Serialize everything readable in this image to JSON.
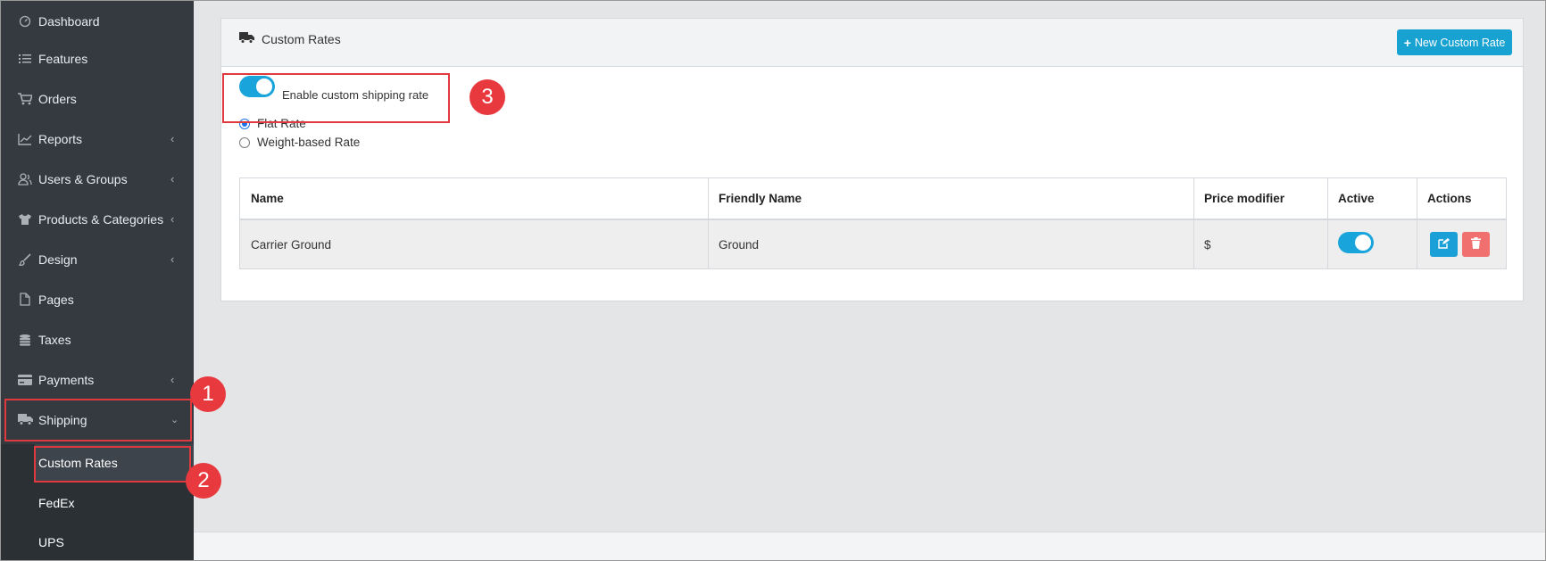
{
  "sidebar": {
    "items": [
      {
        "label": "Dashboard",
        "icon": "dashboard-icon",
        "has_chevron": false
      },
      {
        "label": "Features",
        "icon": "list-icon",
        "has_chevron": false
      },
      {
        "label": "Orders",
        "icon": "cart-icon",
        "has_chevron": false
      },
      {
        "label": "Reports",
        "icon": "chart-line-icon",
        "has_chevron": true
      },
      {
        "label": "Users & Groups",
        "icon": "users-icon",
        "has_chevron": true
      },
      {
        "label": "Products & Categories",
        "icon": "tshirt-icon",
        "has_chevron": true
      },
      {
        "label": "Design",
        "icon": "brush-icon",
        "has_chevron": true
      },
      {
        "label": "Pages",
        "icon": "file-icon",
        "has_chevron": false
      },
      {
        "label": "Taxes",
        "icon": "coins-icon",
        "has_chevron": false
      },
      {
        "label": "Payments",
        "icon": "credit-card-icon",
        "has_chevron": true
      },
      {
        "label": "Shipping",
        "icon": "truck-icon",
        "has_chevron": true,
        "expanded": true
      }
    ],
    "shipping_sub_items": [
      {
        "label": "Custom Rates",
        "active": true
      },
      {
        "label": "FedEx",
        "active": false
      },
      {
        "label": "UPS",
        "active": false
      }
    ]
  },
  "card": {
    "title": "Custom Rates",
    "new_button": "New Custom Rate",
    "enable_toggle": {
      "label": "Enable custom shipping rate",
      "on": true
    },
    "rate_options": [
      {
        "label": "Flat Rate",
        "checked": true
      },
      {
        "label": "Weight-based Rate",
        "checked": false
      }
    ]
  },
  "table": {
    "columns": [
      "Name",
      "Friendly Name",
      "Price modifier",
      "Active",
      "Actions"
    ],
    "rows": [
      {
        "name": "Carrier Ground",
        "friendly_name": "Ground",
        "price_modifier": "$",
        "active": true
      }
    ]
  },
  "annotations": {
    "step1": "1",
    "step2": "2",
    "step3": "3"
  },
  "colors": {
    "sidebar_bg": "#343a40",
    "accent": "#17a2d2",
    "danger": "#f07070",
    "annotation_red": "#e8393f"
  }
}
